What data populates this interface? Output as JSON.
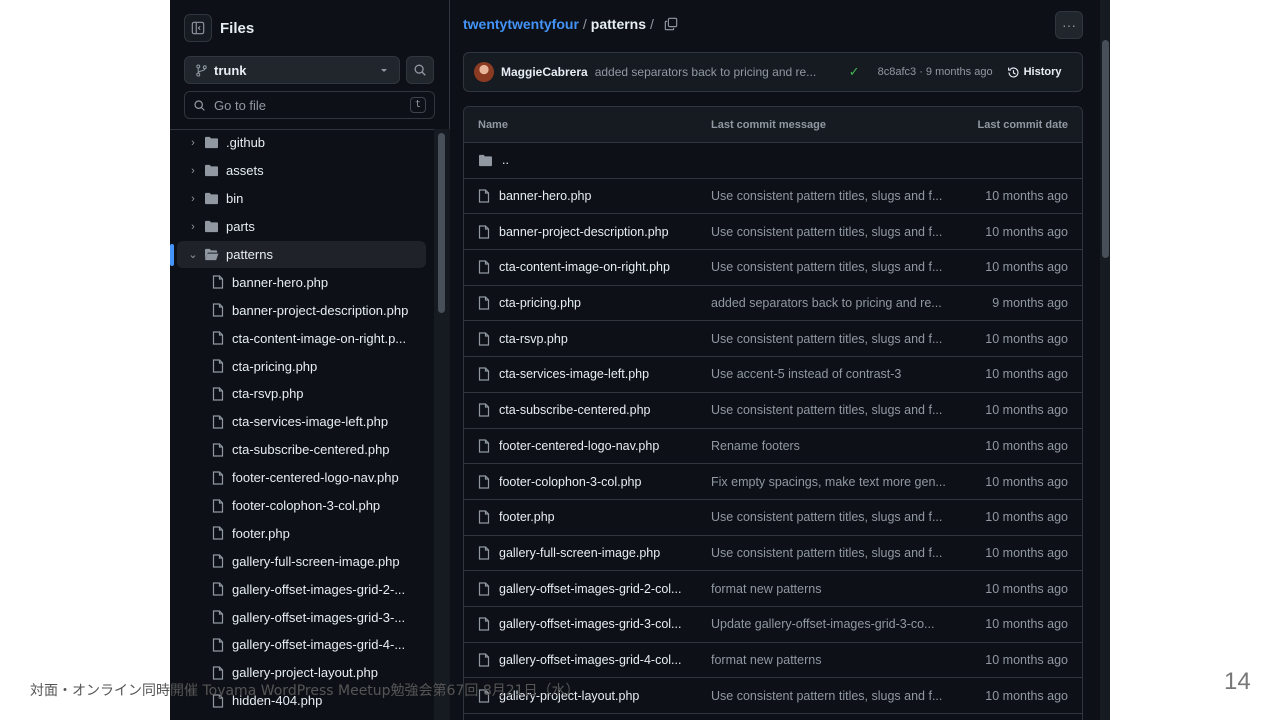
{
  "sidebar": {
    "title": "Files",
    "branch": "trunk",
    "go_to_file_placeholder": "Go to file",
    "go_to_file_shortcut": "t",
    "dirs": [
      ".github",
      "assets",
      "bin",
      "parts",
      "patterns"
    ],
    "selected_dir": "patterns",
    "files": [
      "banner-hero.php",
      "banner-project-description.php",
      "cta-content-image-on-right.p...",
      "cta-pricing.php",
      "cta-rsvp.php",
      "cta-services-image-left.php",
      "cta-subscribe-centered.php",
      "footer-centered-logo-nav.php",
      "footer-colophon-3-col.php",
      "footer.php",
      "gallery-full-screen-image.php",
      "gallery-offset-images-grid-2-...",
      "gallery-offset-images-grid-3-...",
      "gallery-offset-images-grid-4-...",
      "gallery-project-layout.php",
      "hidden-404.php"
    ]
  },
  "breadcrumb": {
    "repo": "twentytwentyfour",
    "sep": "/",
    "current": "patterns",
    "trailing_sep": "/"
  },
  "commit": {
    "author": "MaggieCabrera",
    "message": "added separators back to pricing and re...",
    "sha_time": "8c8afc3 · 9 months ago",
    "history_label": "History"
  },
  "table": {
    "headers": {
      "name": "Name",
      "message": "Last commit message",
      "date": "Last commit date"
    },
    "parent_row": "..",
    "rows": [
      {
        "name": "banner-hero.php",
        "message": "Use consistent pattern titles, slugs and f...",
        "date": "10 months ago"
      },
      {
        "name": "banner-project-description.php",
        "message": "Use consistent pattern titles, slugs and f...",
        "date": "10 months ago"
      },
      {
        "name": "cta-content-image-on-right.php",
        "message": "Use consistent pattern titles, slugs and f...",
        "date": "10 months ago"
      },
      {
        "name": "cta-pricing.php",
        "message": "added separators back to pricing and re...",
        "date": "9 months ago"
      },
      {
        "name": "cta-rsvp.php",
        "message": "Use consistent pattern titles, slugs and f...",
        "date": "10 months ago"
      },
      {
        "name": "cta-services-image-left.php",
        "message": "Use accent-5 instead of contrast-3",
        "date": "10 months ago"
      },
      {
        "name": "cta-subscribe-centered.php",
        "message": "Use consistent pattern titles, slugs and f...",
        "date": "10 months ago"
      },
      {
        "name": "footer-centered-logo-nav.php",
        "message": "Rename footers",
        "date": "10 months ago"
      },
      {
        "name": "footer-colophon-3-col.php",
        "message": "Fix empty spacings, make text more gen...",
        "date": "10 months ago"
      },
      {
        "name": "footer.php",
        "message": "Use consistent pattern titles, slugs and f...",
        "date": "10 months ago"
      },
      {
        "name": "gallery-full-screen-image.php",
        "message": "Use consistent pattern titles, slugs and f...",
        "date": "10 months ago"
      },
      {
        "name": "gallery-offset-images-grid-2-col...",
        "message": "format new patterns",
        "date": "10 months ago"
      },
      {
        "name": "gallery-offset-images-grid-3-col...",
        "message": "Update gallery-offset-images-grid-3-co...",
        "date": "10 months ago"
      },
      {
        "name": "gallery-offset-images-grid-4-col...",
        "message": "format new patterns",
        "date": "10 months ago"
      },
      {
        "name": "gallery-project-layout.php",
        "message": "Use consistent pattern titles, slugs and f...",
        "date": "10 months ago"
      }
    ]
  },
  "slide": {
    "footer": "対面・オンライン同時開催 Toyama WordPress Meetup勉強会第67回 8月21日（水）",
    "page_number": "14"
  },
  "colors": {
    "background": "#0d1117",
    "border": "#30363d",
    "link": "#4493f8",
    "success": "#3fb950"
  }
}
